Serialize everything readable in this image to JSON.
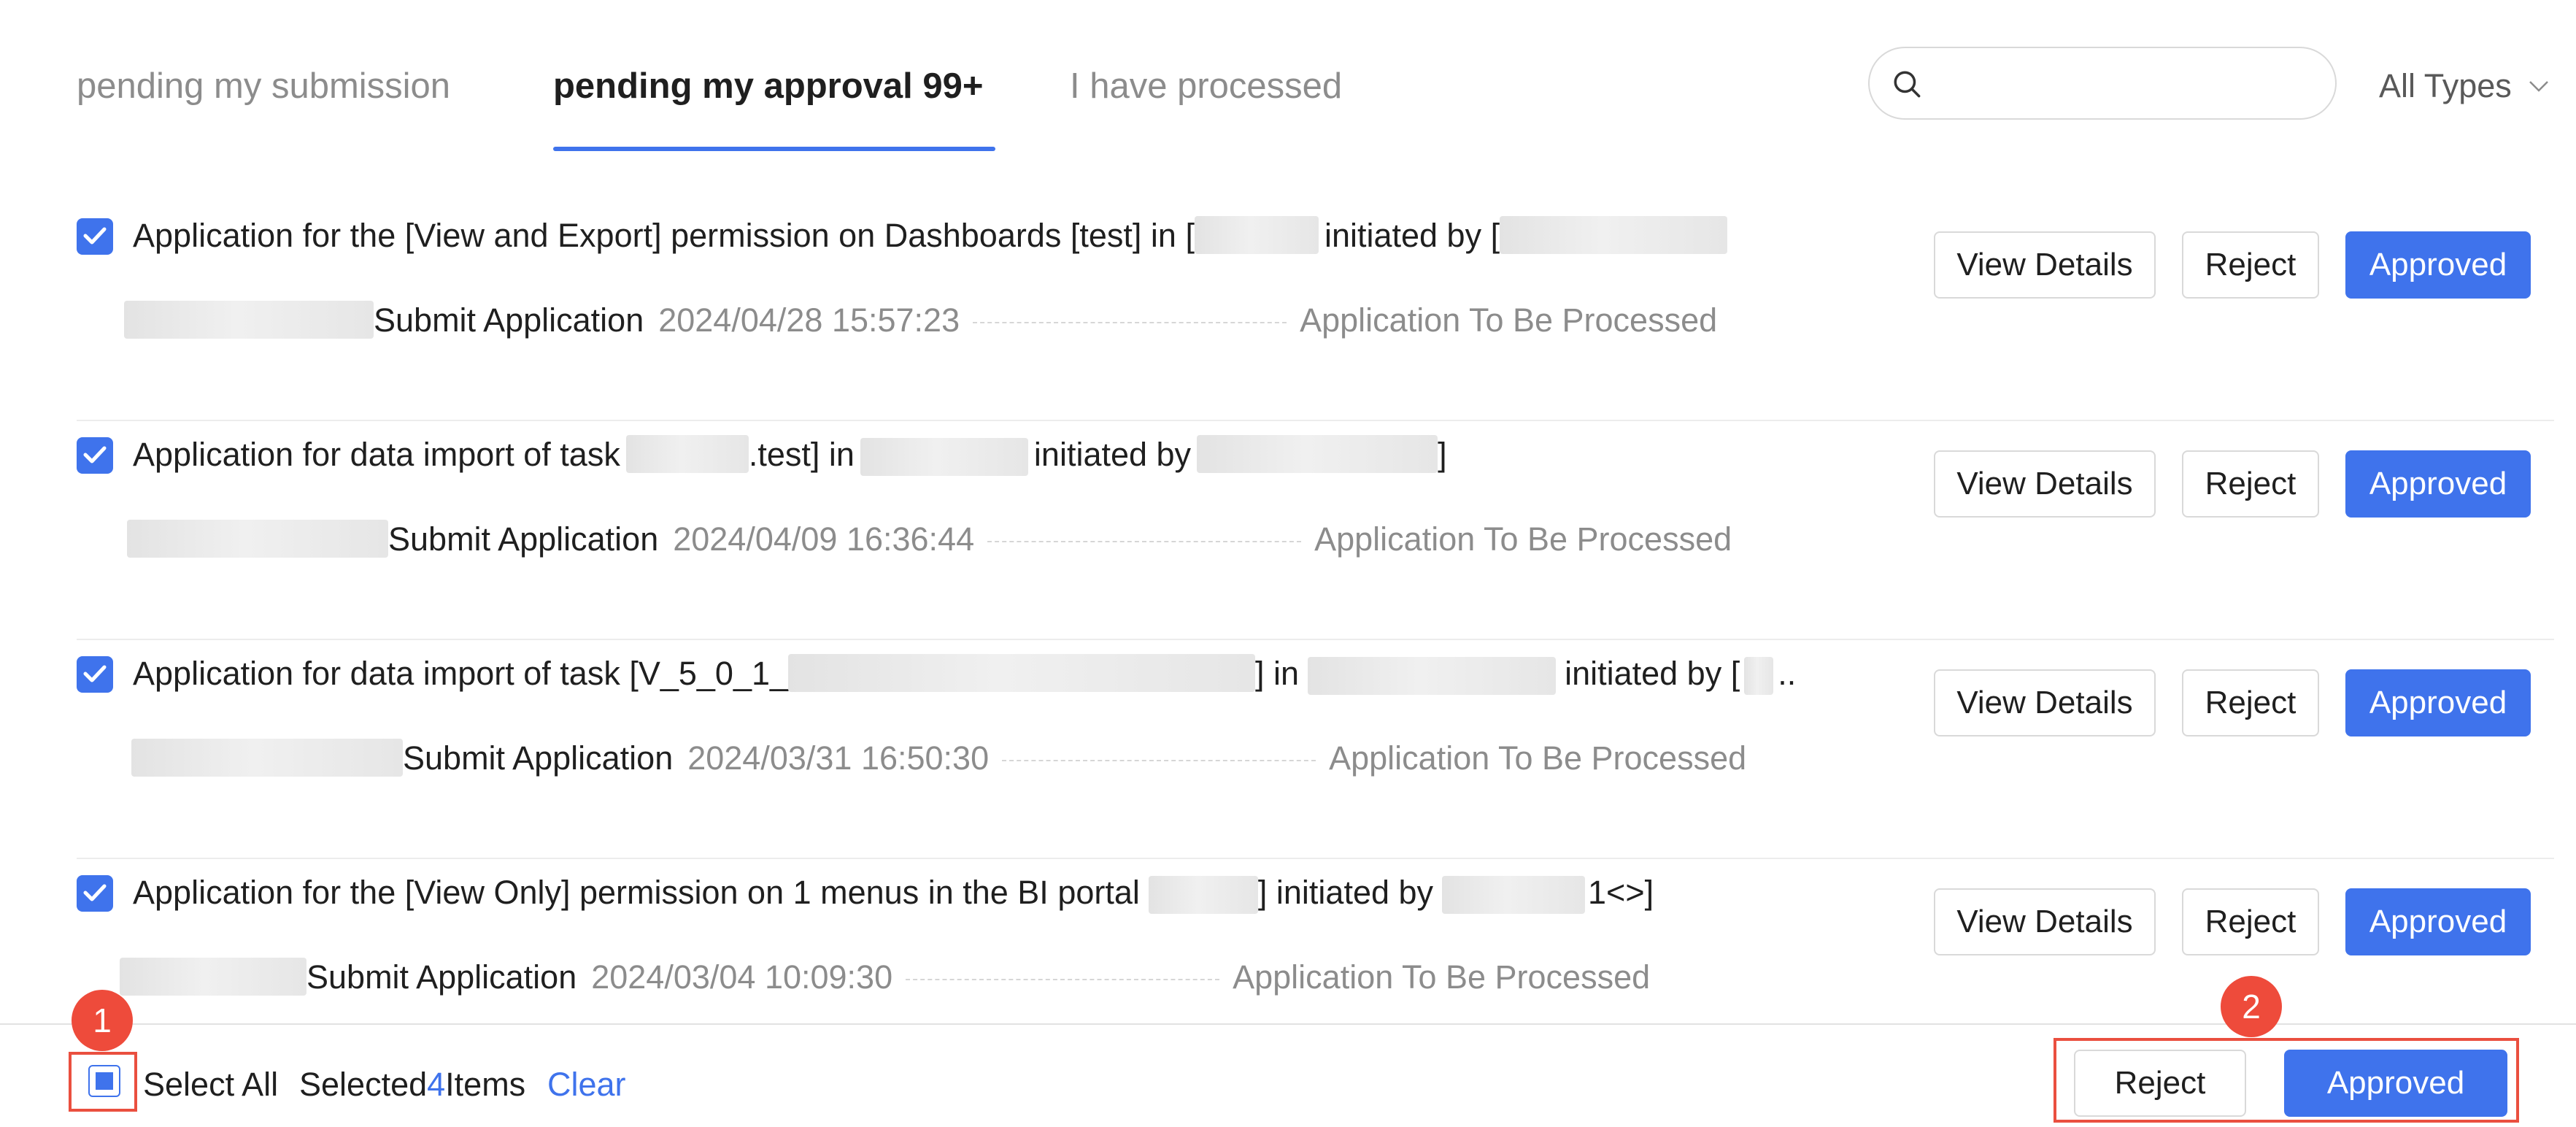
{
  "tabs": [
    {
      "label": "pending my submission"
    },
    {
      "label": "pending my approval 99+"
    },
    {
      "label": "I have processed"
    }
  ],
  "search": {
    "placeholder": "",
    "value": ""
  },
  "type_filter": {
    "label": "All Types"
  },
  "colors": {
    "primary": "#3f73ec",
    "annotation": "#ea4f3f"
  },
  "icons": {
    "search": "search-icon",
    "dropdown": "chevron-down-icon",
    "check": "check-icon"
  },
  "items": [
    {
      "title_parts": [
        "Application for the [View and Export] permission on Dashboards [test] in [",
        "initiated by ["
      ],
      "action": "Submit Application",
      "time": "2024/04/28 15:57:23",
      "status": "Application To Be Processed",
      "checked": true
    },
    {
      "title_parts": [
        "Application for data import of task",
        ".test] in",
        "initiated by",
        "]"
      ],
      "action": "Submit Application",
      "time": "2024/04/09 16:36:44",
      "status": "Application To Be Processed",
      "checked": true
    },
    {
      "title_parts": [
        "Application for data import of task [V_5_0_1_",
        "] in",
        "initiated by [",
        ".."
      ],
      "action": "Submit Application",
      "time": "2024/03/31 16:50:30",
      "status": "Application To Be Processed",
      "checked": true
    },
    {
      "title_parts": [
        "Application for the [View Only] permission on 1 menus in the BI portal",
        "] initiated by",
        "1<>]"
      ],
      "action": "Submit Application",
      "time": "2024/03/04 10:09:30",
      "status": "Application To Be Processed",
      "checked": true
    }
  ],
  "row_actions": {
    "view_details": "View Details",
    "reject": "Reject",
    "approved": "Approved"
  },
  "footer": {
    "select_all": "Select All",
    "selected_prefix": "Selected",
    "selected_count": "4",
    "selected_suffix": "Items",
    "clear": "Clear",
    "reject": "Reject",
    "approved": "Approved"
  },
  "annotations": [
    "1",
    "2"
  ]
}
